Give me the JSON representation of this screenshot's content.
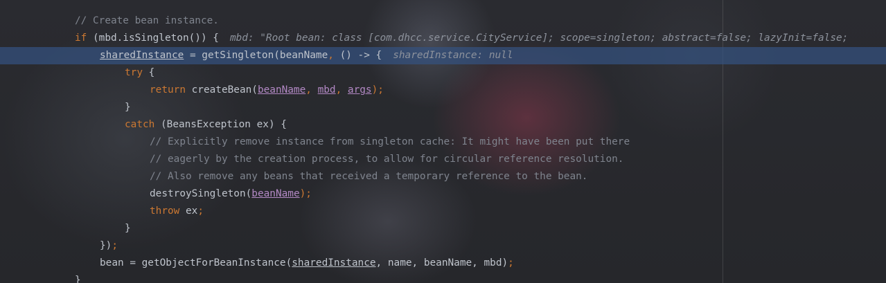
{
  "editor": {
    "lines": [
      {
        "indent": 1,
        "comment": "// Create bean instance."
      },
      {
        "indent": 1,
        "kw": "if",
        "text": " (mbd.isSingleton()) {",
        "hint": "mbd: \"Root bean: class [com.dhcc.service.CityService]; scope=singleton; abstract=false; lazyInit=false;"
      },
      {
        "indent": 2,
        "var": "sharedInstance",
        "text_a": " = getSingleton(beanName",
        "comma": ",",
        "text_b": " () -> {",
        "hint": "sharedInstance: null"
      },
      {
        "indent": 3,
        "kw": "try",
        "text": " {"
      },
      {
        "indent": 4,
        "kw": "return",
        "text": " createBean(",
        "p1": "beanName",
        "sep1": ", ",
        "p2": "mbd",
        "sep2": ", ",
        "p3": "args",
        "close": ");"
      },
      {
        "indent": 3,
        "text": "}"
      },
      {
        "indent": 3,
        "kw": "catch",
        "text": " (BeansException ex) {"
      },
      {
        "indent": 4,
        "comment": "// Explicitly remove instance from singleton cache: It might have been put there"
      },
      {
        "indent": 4,
        "comment": "// eagerly by the creation process, to allow for circular reference resolution."
      },
      {
        "indent": 4,
        "comment": "// Also remove any beans that received a temporary reference to the bean."
      },
      {
        "indent": 4,
        "text": "destroySingleton(",
        "p1": "beanName",
        "close": ");"
      },
      {
        "indent": 4,
        "kw": "throw",
        "text": " ex",
        "close": ";"
      },
      {
        "indent": 3,
        "text": "}"
      },
      {
        "indent": 2,
        "text": "})",
        "close": ";"
      },
      {
        "indent": 2,
        "text_a": "bean = getObjectForBeanInstance(",
        "var": "sharedInstance",
        "text_b": ", name, beanName, mbd)",
        "close": ";"
      },
      {
        "indent": 1,
        "text": "}"
      }
    ]
  }
}
